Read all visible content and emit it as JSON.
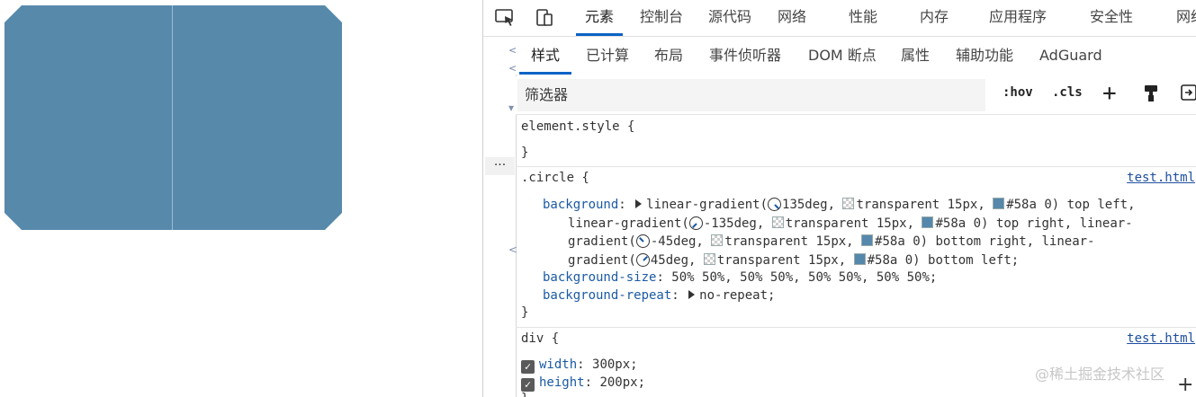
{
  "tabs": [
    "元素",
    "控制台",
    "源代码",
    "网络",
    "性能",
    "内存",
    "应用程序",
    "安全性",
    "网络"
  ],
  "subtabs": [
    "样式",
    "已计算",
    "布局",
    "事件侦听器",
    "DOM 断点",
    "属性",
    "辅助功能",
    "AdGuard"
  ],
  "filter": {
    "placeholder": "筛选器",
    "hov": ":hov",
    "cls": ".cls"
  },
  "colors": {
    "accent": "#0b63c6",
    "shape": "#5789ab",
    "swatch": "#5588aa"
  },
  "css": {
    "element_style_selector": "element.style {",
    "close": "}",
    "circle_selector": ".circle {",
    "circle_src": "test.html",
    "bg_prop": "background",
    "bg_fn1": "linear-gradient(",
    "bg_a1": "135deg,",
    "bg_t1": "transparent 15px,",
    "bg_c1": "#58a 0) top left,",
    "bg_fn2": "linear-gradient(",
    "bg_a2": "-135deg,",
    "bg_t2": "transparent 15px,",
    "bg_c2": "#58a 0) top right, linear-",
    "bg_fn3": "gradient(",
    "bg_a3": "-45deg,",
    "bg_t3": "transparent 15px,",
    "bg_c3": "#58a 0) bottom right, linear-",
    "bg_fn4": "gradient(",
    "bg_a4": "45deg,",
    "bg_t4": "transparent 15px,",
    "bg_c4": "#58a 0) bottom left;",
    "bgsize_prop": "background-size",
    "bgsize_val": "50% 50%, 50% 50%, 50% 50%, 50% 50%;",
    "bgrepeat_prop": "background-repeat",
    "bgrepeat_val": "no-repeat;",
    "div_selector": "div {",
    "div_src": "test.html",
    "width_prop": "width",
    "width_val": "300px;",
    "height_prop": "height",
    "height_val": "200px;"
  },
  "watermark": "@稀土掘金技术社区"
}
